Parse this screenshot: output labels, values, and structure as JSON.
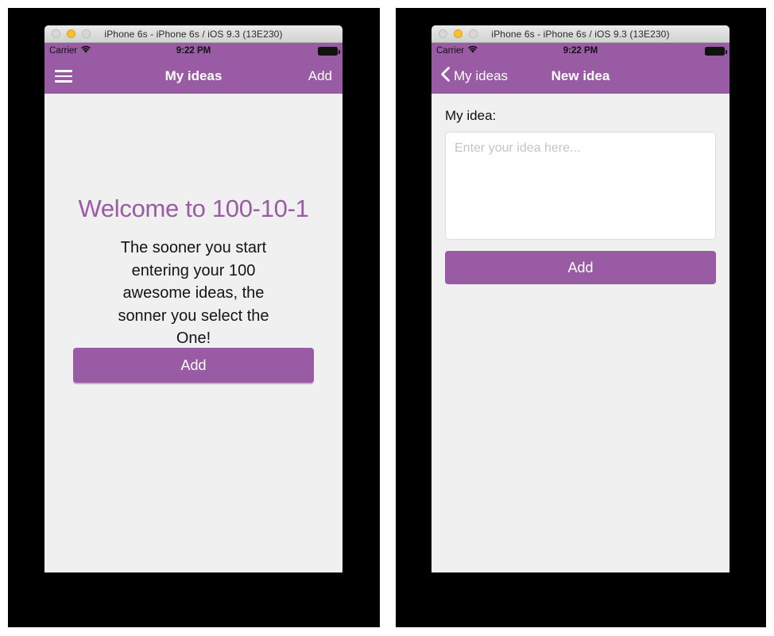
{
  "colors": {
    "accent_purple": "#9a5ba5",
    "content_bg": "#f0f0f0",
    "backdrop": "#000000",
    "titlebar_bg": "#dcdcdc",
    "minimize_yellow": "#fcbf2d",
    "placeholder_grey": "#c4c4c4"
  },
  "simulators": [
    {
      "window_title": "iPhone 6s - iPhone 6s / iOS 9.3 (13E230)",
      "traffic_lights": {
        "close": "close-button",
        "minimize": "minimize-button",
        "zoom": "zoom-button"
      },
      "status_bar": {
        "carrier": "Carrier",
        "wifi_icon": "wifi-icon",
        "time": "9:22 PM",
        "battery_icon": "battery-full-icon"
      },
      "nav_bar": {
        "left_icon": "hamburger-menu-icon",
        "title": "My ideas",
        "right_action": "Add"
      },
      "screen": {
        "heading": "Welcome to 100-10-1",
        "body": "The sooner you start entering your 100 awesome ideas, the sonner you select the One!",
        "primary_button": "Add"
      }
    },
    {
      "window_title": "iPhone 6s - iPhone 6s / iOS 9.3 (13E230)",
      "traffic_lights": {
        "close": "close-button",
        "minimize": "minimize-button",
        "zoom": "zoom-button"
      },
      "status_bar": {
        "carrier": "Carrier",
        "wifi_icon": "wifi-icon",
        "time": "9:22 PM",
        "battery_icon": "battery-full-icon"
      },
      "nav_bar": {
        "back_icon": "chevron-left-icon",
        "back_label": "My ideas",
        "title": "New idea"
      },
      "screen": {
        "field_label": "My idea:",
        "textarea_value": "",
        "textarea_placeholder": "Enter your idea here...",
        "primary_button": "Add"
      }
    }
  ]
}
